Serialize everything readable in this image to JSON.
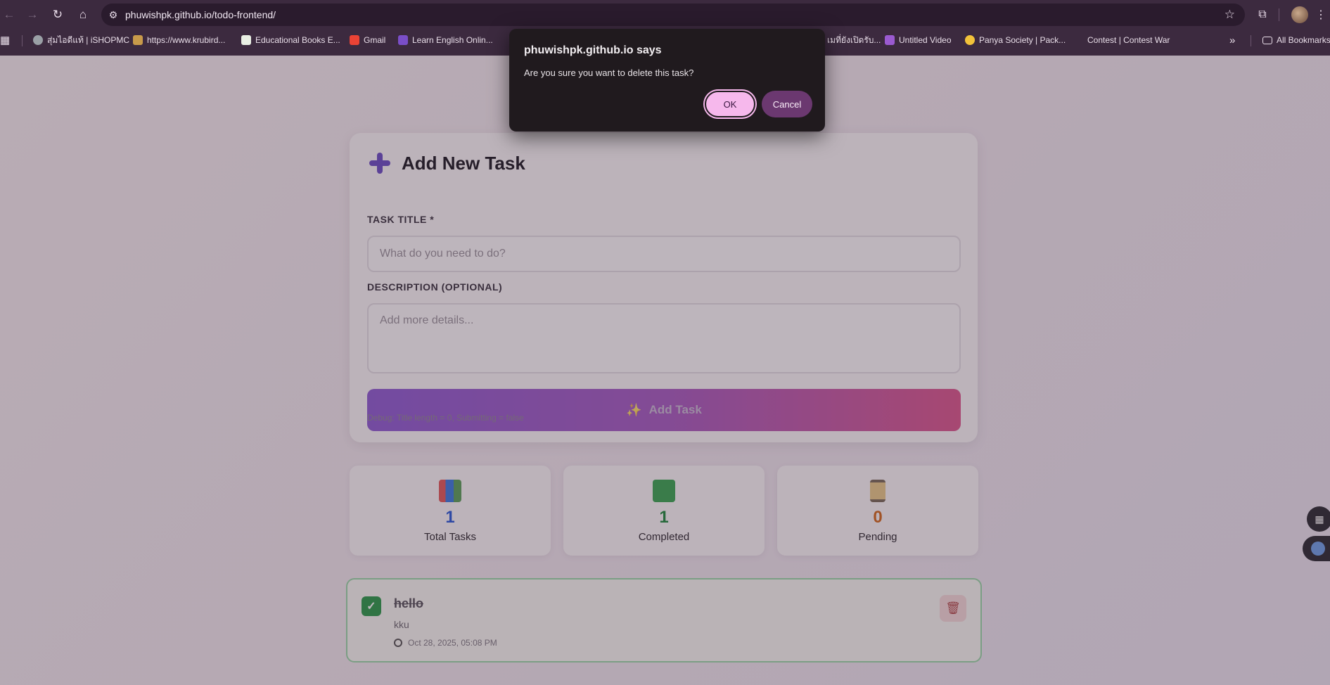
{
  "browser": {
    "url": "phuwishpk.github.io/todo-frontend/",
    "bookmarks": [
      {
        "label": "สุ่มไอดีแท้ | iSHOPMC",
        "color": "#9aa0a6"
      },
      {
        "label": "https://www.krubird...",
        "color": "#c89a4a"
      },
      {
        "label": "Educational Books E...",
        "color": "#e9efe4"
      },
      {
        "label": "Gmail",
        "color": "#ea4335"
      },
      {
        "label": "Learn English Onlin...",
        "color": "#7a4ec8"
      },
      {
        "label": "เมที่ยังเปิดรับ...",
        "color": "#4a8fe0"
      },
      {
        "label": "Untitled Video",
        "color": "#9a5ad0"
      },
      {
        "label": "Panya Society | Pack...",
        "color": "#f2c23a"
      },
      {
        "label": "Contest | Contest War",
        "color": "#3c2a3f"
      }
    ],
    "more_bookmarks": "»",
    "all_bookmarks": "All Bookmarks"
  },
  "icons": {
    "back": "←",
    "forward": "→",
    "reload": "↻",
    "home": "⌂",
    "tune": "⚙",
    "star": "☆",
    "extensions": "⧉",
    "apps": "▦",
    "folder": "▭",
    "sparkle": "✨",
    "check": "✓",
    "trash": "🗑",
    "grid": "▦",
    "menu": "⋮"
  },
  "dialog": {
    "title": "phuwishpk.github.io says",
    "message": "Are you sure you want to delete this task?",
    "ok": "OK",
    "cancel": "Cancel"
  },
  "form": {
    "heading": "Add New Task",
    "title_label": "TASK TITLE *",
    "title_placeholder": "What do you need to do?",
    "title_value": "",
    "desc_label": "DESCRIPTION (OPTIONAL)",
    "desc_placeholder": "Add more details...",
    "desc_value": "",
    "submit": "Add Task",
    "debug": "Debug: Title length = 0, Submitting = false"
  },
  "stats": [
    {
      "value": "1",
      "label": "Total Tasks",
      "color": "#2a5bd7"
    },
    {
      "value": "1",
      "label": "Completed",
      "color": "#1f8a3e"
    },
    {
      "value": "0",
      "label": "Pending",
      "color": "#d2691e"
    }
  ],
  "tasks": [
    {
      "title": "hello",
      "description": "kku",
      "date": "Oct 28, 2025, 05:08 PM",
      "completed": true
    }
  ]
}
